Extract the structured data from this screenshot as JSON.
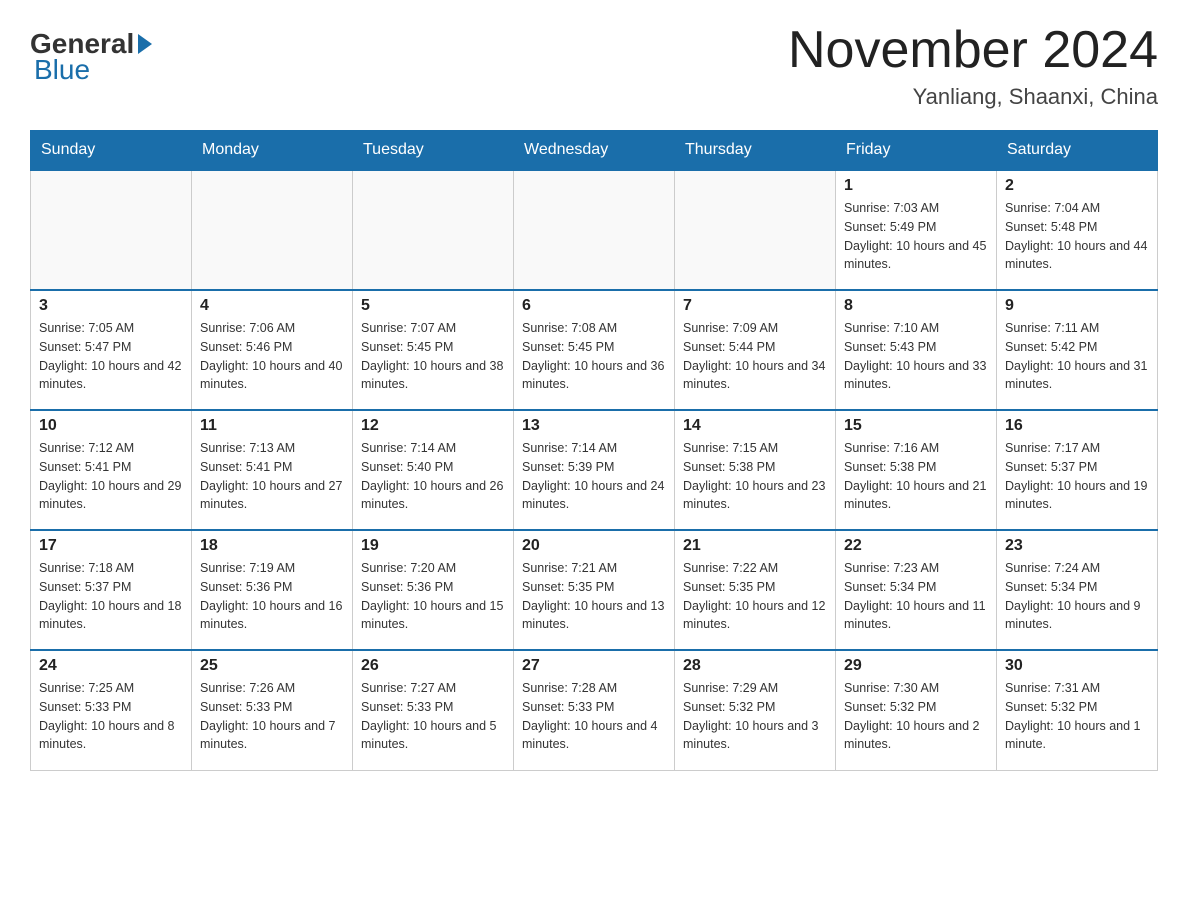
{
  "header": {
    "logo_general": "General",
    "logo_blue": "Blue",
    "month_title": "November 2024",
    "location": "Yanliang, Shaanxi, China"
  },
  "weekdays": [
    "Sunday",
    "Monday",
    "Tuesday",
    "Wednesday",
    "Thursday",
    "Friday",
    "Saturday"
  ],
  "weeks": [
    [
      {
        "day": "",
        "info": ""
      },
      {
        "day": "",
        "info": ""
      },
      {
        "day": "",
        "info": ""
      },
      {
        "day": "",
        "info": ""
      },
      {
        "day": "",
        "info": ""
      },
      {
        "day": "1",
        "info": "Sunrise: 7:03 AM\nSunset: 5:49 PM\nDaylight: 10 hours and 45 minutes."
      },
      {
        "day": "2",
        "info": "Sunrise: 7:04 AM\nSunset: 5:48 PM\nDaylight: 10 hours and 44 minutes."
      }
    ],
    [
      {
        "day": "3",
        "info": "Sunrise: 7:05 AM\nSunset: 5:47 PM\nDaylight: 10 hours and 42 minutes."
      },
      {
        "day": "4",
        "info": "Sunrise: 7:06 AM\nSunset: 5:46 PM\nDaylight: 10 hours and 40 minutes."
      },
      {
        "day": "5",
        "info": "Sunrise: 7:07 AM\nSunset: 5:45 PM\nDaylight: 10 hours and 38 minutes."
      },
      {
        "day": "6",
        "info": "Sunrise: 7:08 AM\nSunset: 5:45 PM\nDaylight: 10 hours and 36 minutes."
      },
      {
        "day": "7",
        "info": "Sunrise: 7:09 AM\nSunset: 5:44 PM\nDaylight: 10 hours and 34 minutes."
      },
      {
        "day": "8",
        "info": "Sunrise: 7:10 AM\nSunset: 5:43 PM\nDaylight: 10 hours and 33 minutes."
      },
      {
        "day": "9",
        "info": "Sunrise: 7:11 AM\nSunset: 5:42 PM\nDaylight: 10 hours and 31 minutes."
      }
    ],
    [
      {
        "day": "10",
        "info": "Sunrise: 7:12 AM\nSunset: 5:41 PM\nDaylight: 10 hours and 29 minutes."
      },
      {
        "day": "11",
        "info": "Sunrise: 7:13 AM\nSunset: 5:41 PM\nDaylight: 10 hours and 27 minutes."
      },
      {
        "day": "12",
        "info": "Sunrise: 7:14 AM\nSunset: 5:40 PM\nDaylight: 10 hours and 26 minutes."
      },
      {
        "day": "13",
        "info": "Sunrise: 7:14 AM\nSunset: 5:39 PM\nDaylight: 10 hours and 24 minutes."
      },
      {
        "day": "14",
        "info": "Sunrise: 7:15 AM\nSunset: 5:38 PM\nDaylight: 10 hours and 23 minutes."
      },
      {
        "day": "15",
        "info": "Sunrise: 7:16 AM\nSunset: 5:38 PM\nDaylight: 10 hours and 21 minutes."
      },
      {
        "day": "16",
        "info": "Sunrise: 7:17 AM\nSunset: 5:37 PM\nDaylight: 10 hours and 19 minutes."
      }
    ],
    [
      {
        "day": "17",
        "info": "Sunrise: 7:18 AM\nSunset: 5:37 PM\nDaylight: 10 hours and 18 minutes."
      },
      {
        "day": "18",
        "info": "Sunrise: 7:19 AM\nSunset: 5:36 PM\nDaylight: 10 hours and 16 minutes."
      },
      {
        "day": "19",
        "info": "Sunrise: 7:20 AM\nSunset: 5:36 PM\nDaylight: 10 hours and 15 minutes."
      },
      {
        "day": "20",
        "info": "Sunrise: 7:21 AM\nSunset: 5:35 PM\nDaylight: 10 hours and 13 minutes."
      },
      {
        "day": "21",
        "info": "Sunrise: 7:22 AM\nSunset: 5:35 PM\nDaylight: 10 hours and 12 minutes."
      },
      {
        "day": "22",
        "info": "Sunrise: 7:23 AM\nSunset: 5:34 PM\nDaylight: 10 hours and 11 minutes."
      },
      {
        "day": "23",
        "info": "Sunrise: 7:24 AM\nSunset: 5:34 PM\nDaylight: 10 hours and 9 minutes."
      }
    ],
    [
      {
        "day": "24",
        "info": "Sunrise: 7:25 AM\nSunset: 5:33 PM\nDaylight: 10 hours and 8 minutes."
      },
      {
        "day": "25",
        "info": "Sunrise: 7:26 AM\nSunset: 5:33 PM\nDaylight: 10 hours and 7 minutes."
      },
      {
        "day": "26",
        "info": "Sunrise: 7:27 AM\nSunset: 5:33 PM\nDaylight: 10 hours and 5 minutes."
      },
      {
        "day": "27",
        "info": "Sunrise: 7:28 AM\nSunset: 5:33 PM\nDaylight: 10 hours and 4 minutes."
      },
      {
        "day": "28",
        "info": "Sunrise: 7:29 AM\nSunset: 5:32 PM\nDaylight: 10 hours and 3 minutes."
      },
      {
        "day": "29",
        "info": "Sunrise: 7:30 AM\nSunset: 5:32 PM\nDaylight: 10 hours and 2 minutes."
      },
      {
        "day": "30",
        "info": "Sunrise: 7:31 AM\nSunset: 5:32 PM\nDaylight: 10 hours and 1 minute."
      }
    ]
  ]
}
